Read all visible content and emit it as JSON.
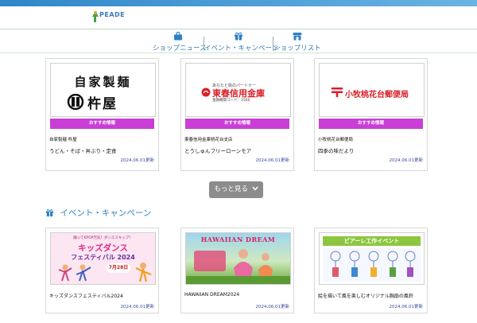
{
  "header": {
    "logo_text": "PEADE"
  },
  "nav": [
    {
      "label": "ショップニュース",
      "icon": "shopping-bag-icon"
    },
    {
      "label": "イベント・キャンペーン",
      "icon": "gift-icon"
    },
    {
      "label": "ショップリスト",
      "icon": "store-icon"
    }
  ],
  "shop_news": [
    {
      "logo_line1": "自家製麺",
      "logo_line2": "杵屋",
      "badge": "おすすめ情報",
      "name": "自家製麺 杵屋",
      "desc": "うどん・そば・丼ぶり・定食",
      "date": "2024.06.01更新"
    },
    {
      "logo_small": "あなたと街のパートナー",
      "logo_main": "東春信用金庫",
      "logo_code": "金融機関コード：1560",
      "badge": "おすすめ情報",
      "name": "東春信用金庫桃花台支店",
      "desc": "とうしゅんフリーローンモア",
      "date": "2024.06.01更新"
    },
    {
      "logo_main": "小牧桃花台郵便局",
      "badge": "おすすめ情報",
      "name": "小牧桃花台郵便局",
      "desc": "四季の味だより",
      "date": "2024.06.01更新"
    }
  ],
  "more_button": "もっと見る",
  "events_section": {
    "title": "イベント・キャンペーン"
  },
  "events": [
    {
      "poster_top": "踊ってKPOP元気！ダンススキップ！",
      "poster_title1": "キッズダンス",
      "poster_title2": "フェスティバル 2024",
      "poster_date": "7月28日",
      "title": "キッズダンスフェスティバル2024",
      "date": "2024.06.01更新"
    },
    {
      "poster_title": "HAWAIIAN DREAM",
      "title": "HAWAIIAN DREAM2024",
      "date": "2024.06.01更新"
    },
    {
      "poster_title": "ピアーレ工作イベント",
      "title": "絵を描いて風を楽しむオリジナル胸扇の風鈴",
      "date": "2024.06.01更新"
    }
  ],
  "colors": {
    "accent": "#2e80c4",
    "badge": "#c93fd6",
    "more_bg": "#8c8c8c"
  }
}
